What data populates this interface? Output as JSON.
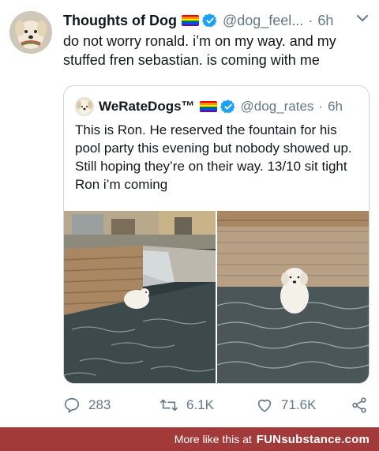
{
  "tweet": {
    "author_name": "Thoughts of Dog",
    "author_handle": "@dog_feel...",
    "separator": "·",
    "time": "6h",
    "text": "do not worry ronald. i’m on my way. and my stuffed fren sebastian. is coming with me",
    "icons": [
      "pride-flag-icon",
      "verified-badge-icon",
      "chevron-down-icon"
    ]
  },
  "quoted_tweet": {
    "author_name": "WeRateDogs™",
    "author_handle": "@dog_rates",
    "separator": "·",
    "time": "6h",
    "text": "This is Ron. He reserved the fountain for his pool party this evening but nobody showed up. Still hoping they’re on their way. 13/10 sit tight Ron i’m coming"
  },
  "actions": {
    "reply_count": "283",
    "retweet_count": "6.1K",
    "like_count": "71.6K",
    "icons": [
      "reply-icon",
      "retweet-icon",
      "like-icon",
      "share-icon"
    ]
  },
  "banner": {
    "text": "More like this at",
    "brand": "FUNsubstance.com"
  },
  "colors": {
    "text": "#14171a",
    "secondary": "#657786",
    "verified": "#1da1f2",
    "banner_bg": "#a33a3a",
    "border": "#ccd6dd"
  }
}
